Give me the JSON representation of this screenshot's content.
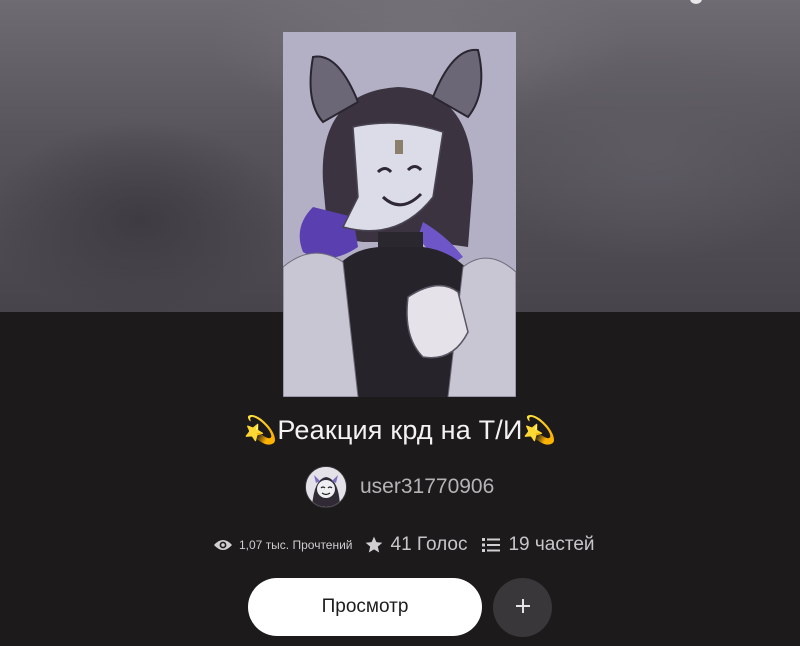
{
  "story": {
    "title": "💫Реакция крд на Т/И💫",
    "cover_icon": "illustration-cover"
  },
  "author": {
    "username": "user31770906",
    "avatar_icon": "avatar-illustration"
  },
  "stats": {
    "reads_label": "1,07 тыс. Прочтений",
    "votes_label": "41 Голос",
    "parts_label": "19 частей",
    "reads_icon": "eye-icon",
    "votes_icon": "star-icon",
    "parts_icon": "list-icon"
  },
  "actions": {
    "read_label": "Просмотр",
    "add_icon": "plus-icon"
  },
  "colors": {
    "background": "#1c1a1b",
    "primary_button": "#ffffff",
    "secondary_button": "#39373a",
    "text_primary": "#f4f2f3",
    "text_muted": "#b6b3b6"
  }
}
